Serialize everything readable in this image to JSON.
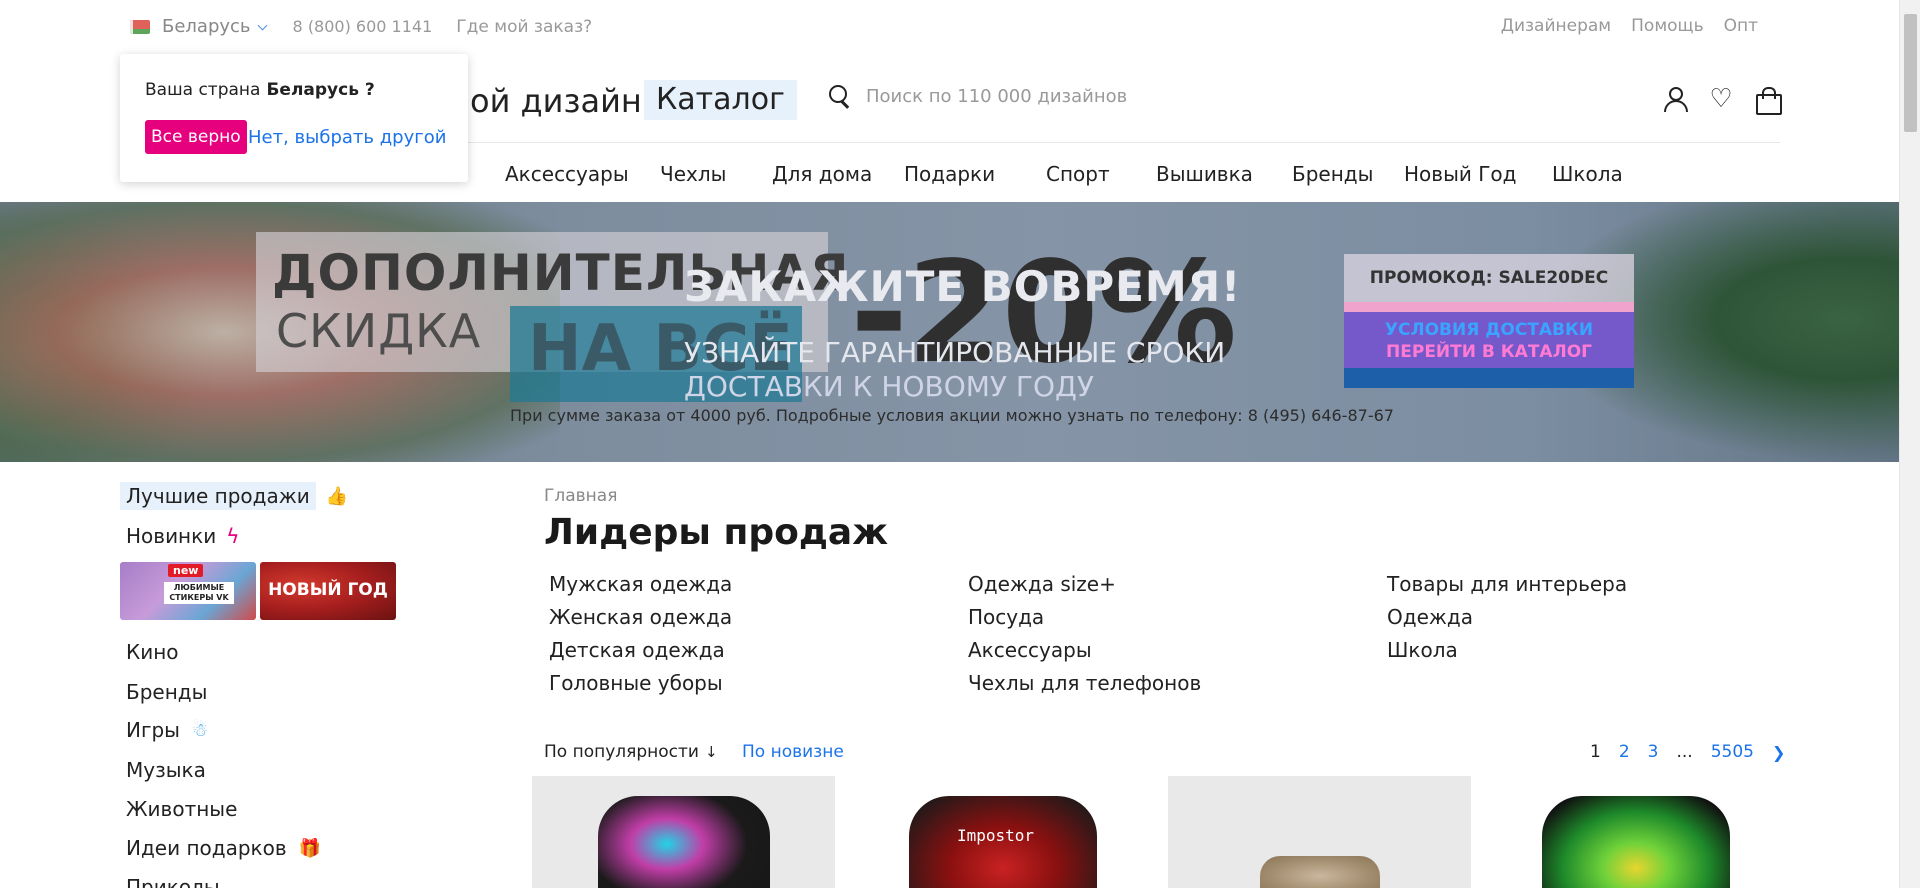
{
  "topbar": {
    "country": "Беларусь",
    "phone": "8 (800) 600 1141",
    "where_order": "Где мой заказ?",
    "right_links": [
      "Дизайнерам",
      "Помощь",
      "Опт"
    ]
  },
  "header": {
    "logo_text": "ой дизайн",
    "catalog_button": "Каталог",
    "search_placeholder": "Поиск по 110 000 дизайнов"
  },
  "nav": {
    "items": [
      "Аксессуары",
      "Чехлы",
      "Для дома",
      "Подарки",
      "Спорт",
      "Вышивка",
      "Бренды",
      "Новый Год",
      "Школа"
    ]
  },
  "country_popup": {
    "question": "Ваша страна",
    "country": "Беларусь ?",
    "confirm_button": "Все верно",
    "change_link": "Нет, выбрать другой"
  },
  "banner": {
    "line1": "ДОПОЛНИТЕЛЬНАЯ",
    "line2": "СКИДКА",
    "line3": "НА ВСЁ",
    "discount": "-20%",
    "headline": "ЗАКАЖИТЕ ВОВРЕМЯ!",
    "sub1": "УЗНАЙТЕ ГАРАНТИРОВАННЫЕ СРОКИ",
    "sub2": "ДОСТАВКИ К НОВОМУ ГОДУ",
    "note": "При сумме заказа от 4000 руб. Подробные условия акции можно узнать по телефону: 8 (495) 646-87-67",
    "promo_code": "ПРОМОКОД: SALE20DEC",
    "promo_delivery": "УСЛОВИЯ ДОСТАВКИ",
    "promo_catalog": "ПЕРЕЙТИ В КАТАЛОГ"
  },
  "sidebar": {
    "best": "Лучшие продажи",
    "new": "Новинки",
    "tile1_badge": "new",
    "tile1_text": "ЛЮБИМЫЕ СТИКЕРЫ VK",
    "tile2_text": "НОВЫЙ ГОД",
    "items": [
      "Кино",
      "Бренды",
      "Игры",
      "Музыка",
      "Животные",
      "Идеи подарков",
      "Приколы"
    ]
  },
  "main": {
    "breadcrumb": "Главная",
    "title": "Лидеры продаж",
    "categories_col1": [
      "Мужская одежда",
      "Женская одежда",
      "Детская одежда",
      "Головные уборы"
    ],
    "categories_col2": [
      "Одежда size+",
      "Посуда",
      "Аксессуары",
      "Чехлы для телефонов"
    ],
    "categories_col3": [
      "Товары для интерьера",
      "Одежда",
      "Школа"
    ],
    "sort_popular": "По популярности",
    "sort_newest": "По новизне",
    "pager": {
      "current": "1",
      "p2": "2",
      "p3": "3",
      "dots": "...",
      "last": "5505"
    },
    "product2_print": "Impostor"
  },
  "colors": {
    "accent_pink": "#e6007e",
    "link_blue": "#1a73e8",
    "highlight_bg": "#e7f1fb"
  }
}
